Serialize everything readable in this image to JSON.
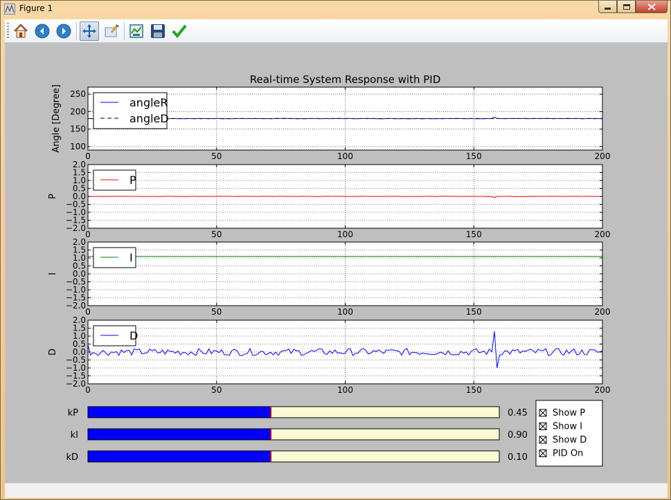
{
  "window": {
    "title": "Figure 1"
  },
  "toolbar": {
    "buttons": [
      {
        "name": "home-icon"
      },
      {
        "name": "back-icon"
      },
      {
        "name": "forward-icon"
      },
      {
        "name": "pan-icon"
      },
      {
        "name": "zoom-icon"
      },
      {
        "name": "subplots-icon"
      },
      {
        "name": "save-icon"
      },
      {
        "name": "check-icon"
      }
    ]
  },
  "chart_data": [
    {
      "type": "line",
      "title": "Real-time System Response with PID",
      "ylabel": "Angle [Degree]",
      "xlim": [
        0,
        200
      ],
      "ylim": [
        90,
        270
      ],
      "xticks": [
        0,
        50,
        100,
        150,
        200
      ],
      "yticks": [
        100,
        150,
        200,
        250
      ],
      "grid": true,
      "legend": "upper left",
      "series": [
        {
          "name": "angleR",
          "color": "#0000ff",
          "style": "solid",
          "base": 180,
          "noise": 0.6,
          "spike": {
            "x": 158,
            "value": 184
          }
        },
        {
          "name": "angleD",
          "color": "#000000",
          "style": "dashed",
          "base": 180,
          "noise": 0
        }
      ]
    },
    {
      "type": "line",
      "ylabel": "P",
      "xlim": [
        0,
        200
      ],
      "ylim": [
        -2,
        2
      ],
      "xticks": [
        0,
        50,
        100,
        150,
        200
      ],
      "yticks": [
        -2.0,
        -1.5,
        -1.0,
        -0.5,
        0.0,
        0.5,
        1.0,
        1.5,
        2.0
      ],
      "grid": true,
      "legend": "upper left",
      "series": [
        {
          "name": "P",
          "color": "#ff0000",
          "style": "solid",
          "base": 0.0,
          "noise": 0.01,
          "spike": {
            "x": 158,
            "value": -0.08
          }
        }
      ]
    },
    {
      "type": "line",
      "ylabel": "I",
      "xlim": [
        0,
        200
      ],
      "ylim": [
        -2,
        2
      ],
      "xticks": [
        0,
        50,
        100,
        150,
        200
      ],
      "yticks": [
        -2.0,
        -1.5,
        -1.0,
        -0.5,
        0.0,
        0.5,
        1.0,
        1.5,
        2.0
      ],
      "grid": true,
      "legend": "upper left",
      "series": [
        {
          "name": "I",
          "color": "#008000",
          "style": "solid",
          "base": 1.1,
          "noise": 0
        }
      ]
    },
    {
      "type": "line",
      "ylabel": "D",
      "xlim": [
        0,
        200
      ],
      "ylim": [
        -2,
        2
      ],
      "xticks": [
        0,
        50,
        100,
        150,
        200
      ],
      "yticks": [
        -2.0,
        -1.5,
        -1.0,
        -0.5,
        0.0,
        0.5,
        1.0,
        1.5,
        2.0
      ],
      "grid": true,
      "legend": "upper left",
      "series": [
        {
          "name": "D",
          "color": "#0000ff",
          "style": "solid",
          "base": 0.0,
          "noise": 0.22,
          "start": 0.45,
          "spike": {
            "x": 158,
            "value": 1.3,
            "after": -1.0
          }
        }
      ]
    }
  ],
  "sliders": [
    {
      "label": "kP",
      "value_text": "0.45",
      "fill_fraction": 0.445
    },
    {
      "label": "kI",
      "value_text": "0.90",
      "fill_fraction": 0.445
    },
    {
      "label": "kD",
      "value_text": "0.10",
      "fill_fraction": 0.445
    }
  ],
  "checkboxes": [
    {
      "label": "Show P",
      "checked": true
    },
    {
      "label": "Show I",
      "checked": true
    },
    {
      "label": "Show D",
      "checked": true
    },
    {
      "label": "PID On",
      "checked": true
    }
  ],
  "colors": {
    "slider_fill": "#0000ff",
    "slider_track": "#fafad2",
    "slider_marker": "#ff0000",
    "canvas_bg": "#bfbfbf"
  }
}
